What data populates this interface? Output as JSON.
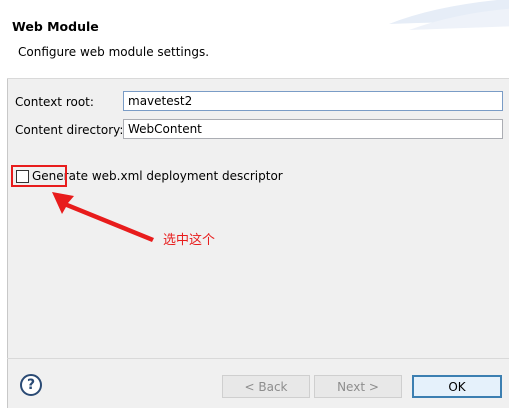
{
  "header": {
    "title": "Web Module",
    "description": "Configure web module settings."
  },
  "form": {
    "context_root_label": "Context root:",
    "context_root_value": "mavetest2",
    "content_dir_label": "Content directory:",
    "content_dir_value": "WebContent",
    "generate_checkbox_label": "Generate web.xml deployment descriptor",
    "generate_checked": false
  },
  "annotation": {
    "text": "选中这个",
    "color": "#e81c1c"
  },
  "buttons": {
    "help_icon": "?",
    "back": "< Back",
    "next": "Next >",
    "ok": "OK"
  },
  "colors": {
    "accent": "#3c7fb1",
    "annotation_red": "#e81c1c",
    "input_focus_border": "#7a9cc6"
  }
}
